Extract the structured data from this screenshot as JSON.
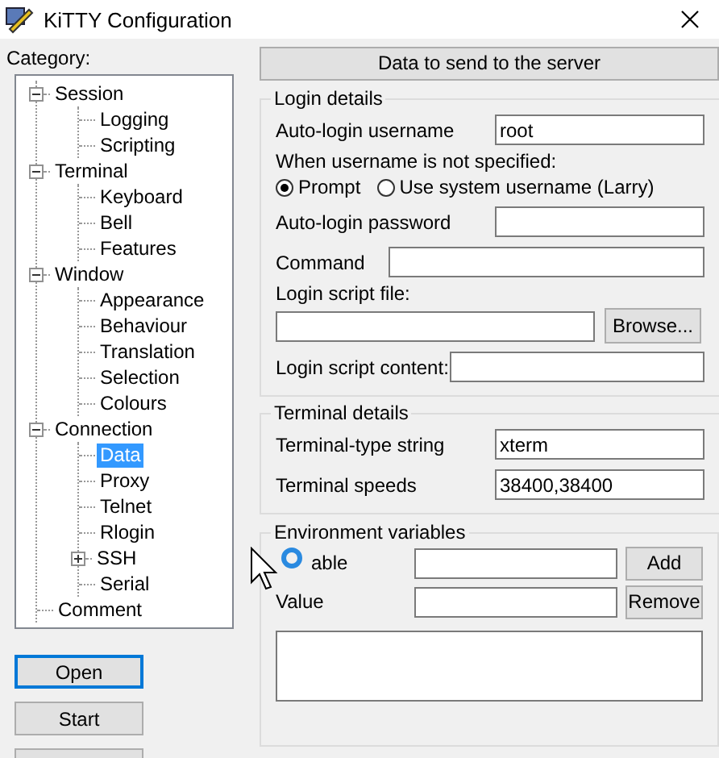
{
  "window": {
    "title": "KiTTY Configuration"
  },
  "category_label": "Category:",
  "tree": [
    {
      "label": "Session",
      "expanded": true,
      "selected": false,
      "children": [
        {
          "label": "Logging",
          "selected": false
        },
        {
          "label": "Scripting",
          "selected": false
        }
      ]
    },
    {
      "label": "Terminal",
      "expanded": true,
      "selected": false,
      "children": [
        {
          "label": "Keyboard",
          "selected": false
        },
        {
          "label": "Bell",
          "selected": false
        },
        {
          "label": "Features",
          "selected": false
        }
      ]
    },
    {
      "label": "Window",
      "expanded": true,
      "selected": false,
      "children": [
        {
          "label": "Appearance",
          "selected": false
        },
        {
          "label": "Behaviour",
          "selected": false
        },
        {
          "label": "Translation",
          "selected": false
        },
        {
          "label": "Selection",
          "selected": false
        },
        {
          "label": "Colours",
          "selected": false
        }
      ]
    },
    {
      "label": "Connection",
      "expanded": true,
      "selected": false,
      "children": [
        {
          "label": "Data",
          "selected": true
        },
        {
          "label": "Proxy",
          "selected": false
        },
        {
          "label": "Telnet",
          "selected": false
        },
        {
          "label": "Rlogin",
          "selected": false
        },
        {
          "label": "SSH",
          "expanded": false,
          "selected": false
        },
        {
          "label": "Serial",
          "selected": false
        }
      ]
    },
    {
      "label": "Comment",
      "selected": false
    }
  ],
  "buttons": [
    {
      "label": "Open",
      "default": true
    },
    {
      "label": "Start",
      "default": false
    }
  ],
  "panel": {
    "header": "Data to send to the server",
    "login": {
      "title": "Login details",
      "username_label": "Auto-login username",
      "username": "root",
      "when_label": "When username is not specified:",
      "radios": [
        {
          "label": "Prompt",
          "selected": true
        },
        {
          "label": "Use system username (Larry)",
          "selected": false
        }
      ],
      "password_label": "Auto-login password",
      "command_label": "Command",
      "script_file_label": "Login script file:",
      "browse": "Browse...",
      "script_content_label": "Login script content:"
    },
    "terminal": {
      "title": "Terminal details",
      "rows": [
        {
          "label": "Terminal-type string",
          "value": "xterm"
        },
        {
          "label": "Terminal speeds",
          "value": "38400,38400"
        }
      ]
    },
    "env": {
      "title": "Environment variables",
      "variable_label": "able",
      "value_label": "Value",
      "add": "Add",
      "remove": "Remove"
    }
  }
}
